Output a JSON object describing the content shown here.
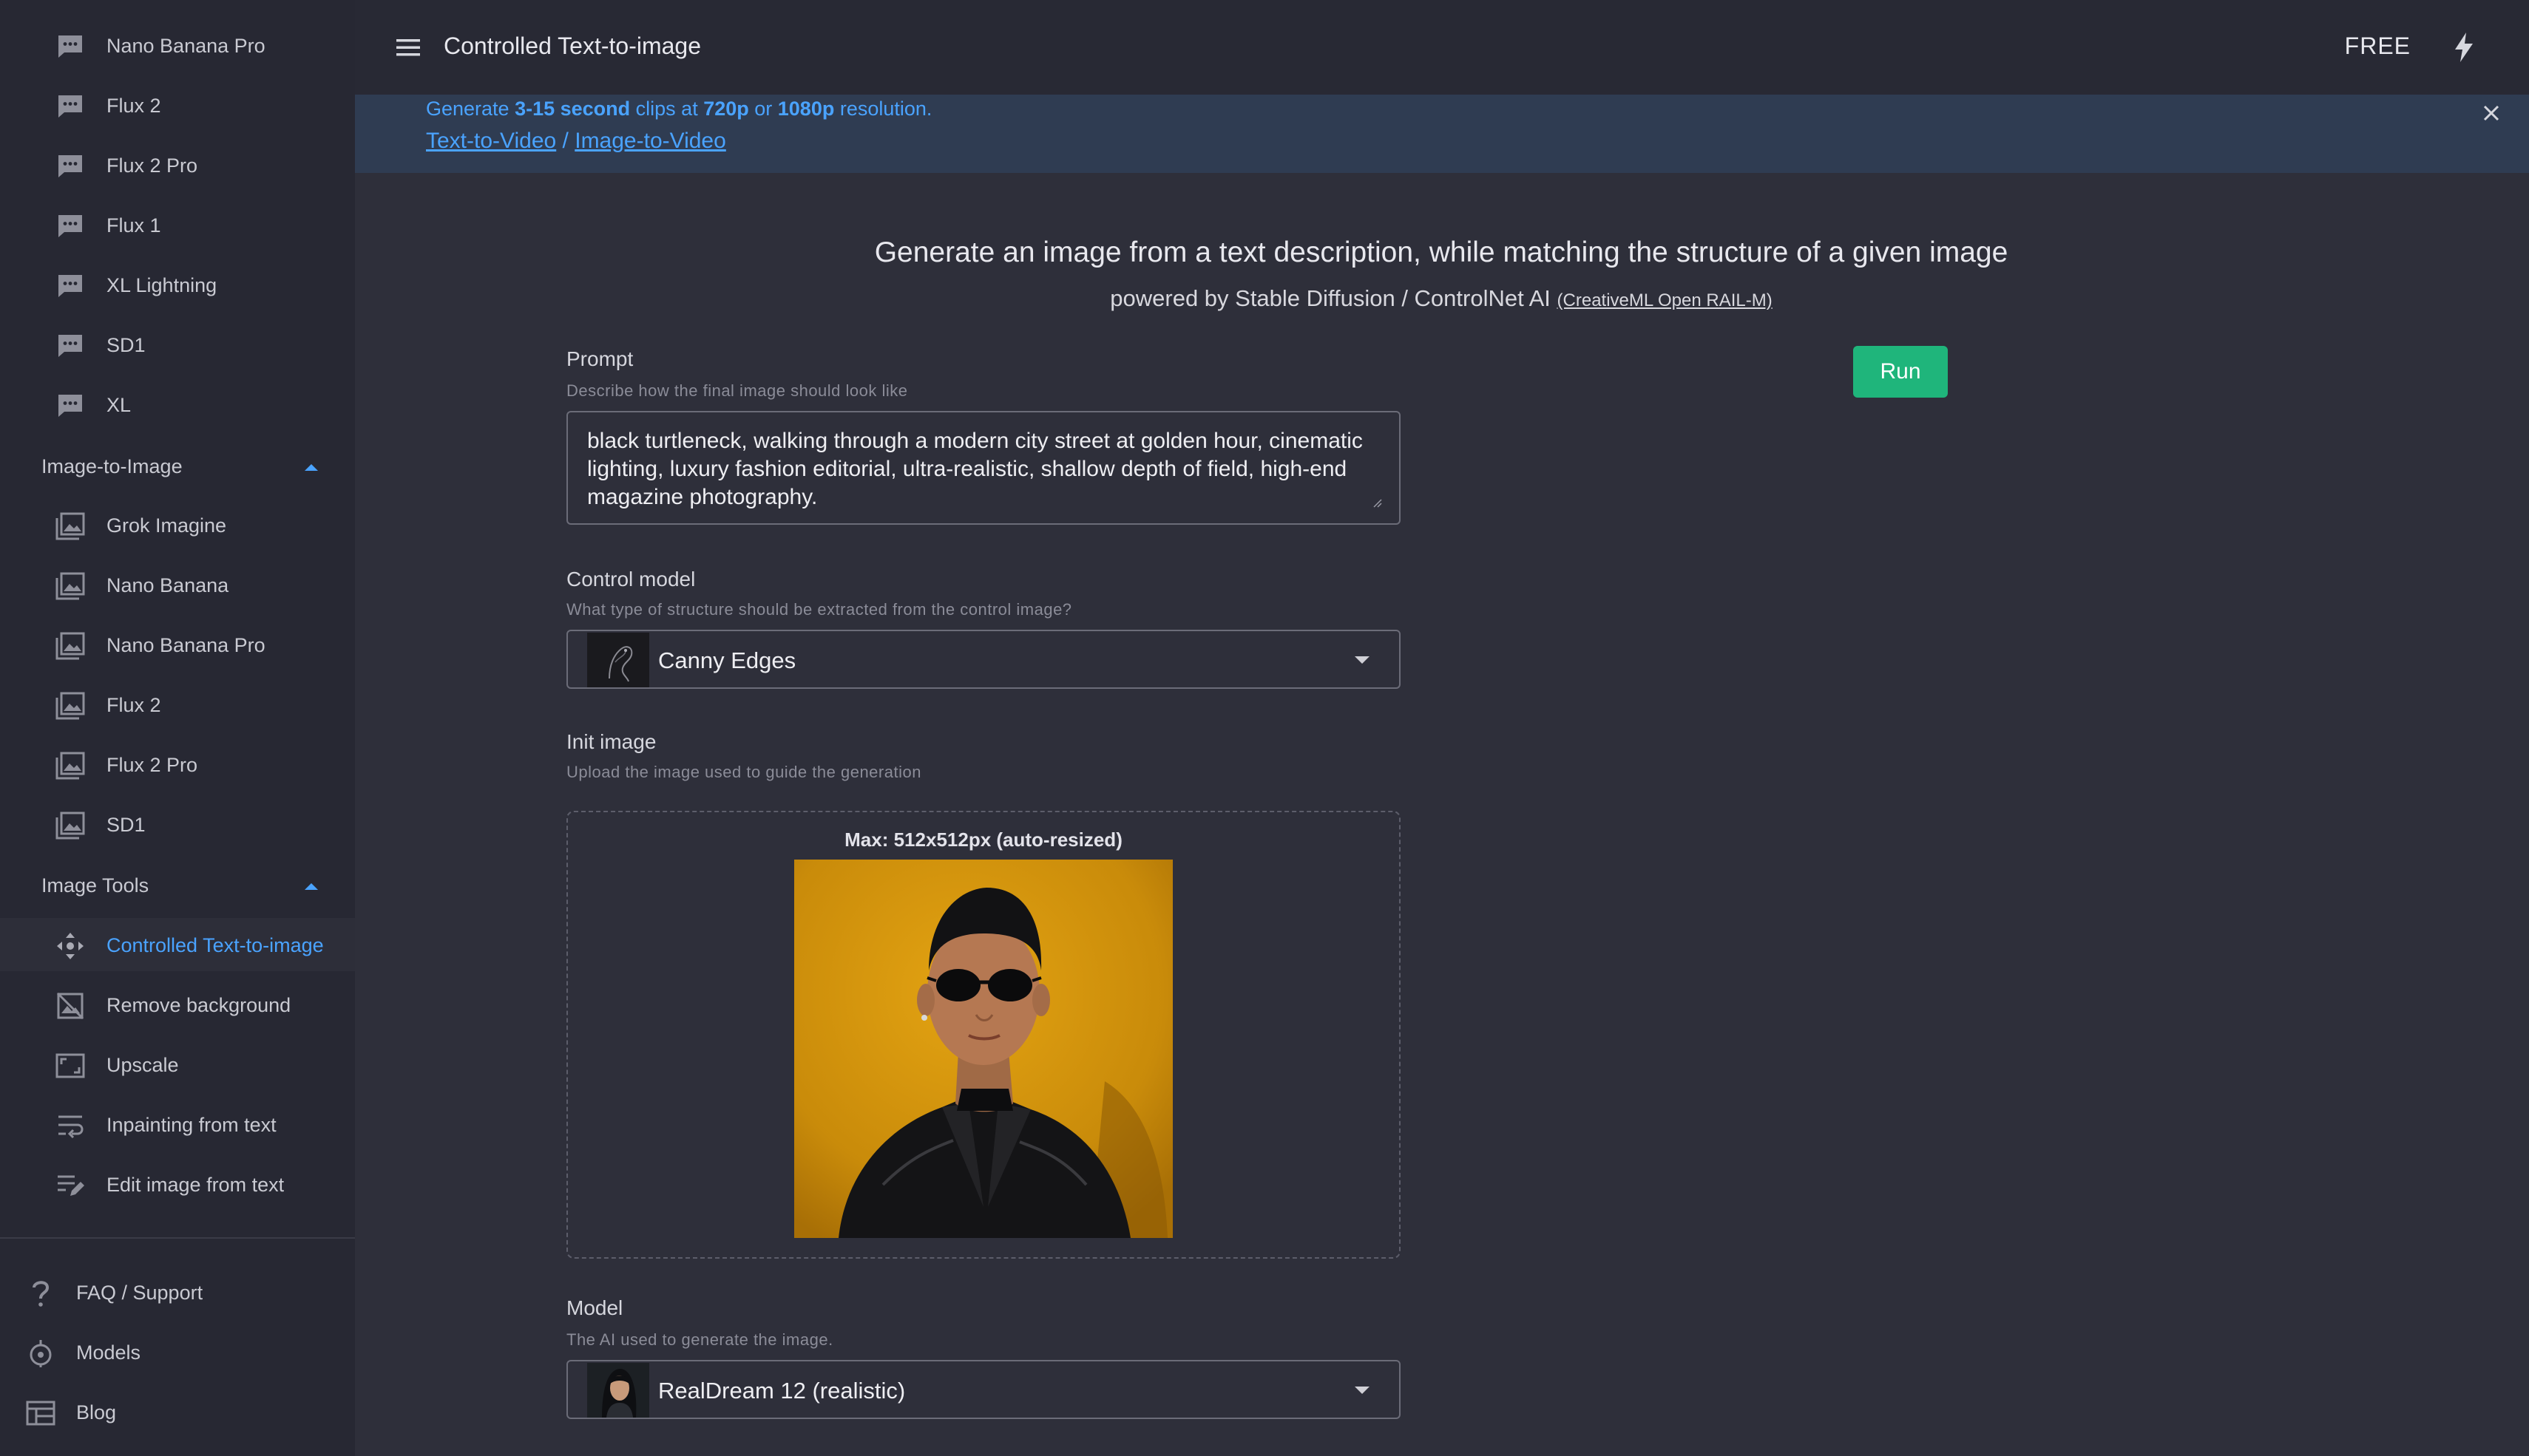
{
  "sidebar": {
    "text_to_image_items": [
      {
        "label": "Nano Banana Pro",
        "icon": "chat-bubble-icon"
      },
      {
        "label": "Flux 2",
        "icon": "chat-bubble-icon"
      },
      {
        "label": "Flux 2 Pro",
        "icon": "chat-bubble-icon"
      },
      {
        "label": "Flux 1",
        "icon": "chat-bubble-icon"
      },
      {
        "label": "XL Lightning",
        "icon": "chat-bubble-icon"
      },
      {
        "label": "SD1",
        "icon": "chat-bubble-icon"
      },
      {
        "label": "XL",
        "icon": "chat-bubble-icon"
      }
    ],
    "image_to_image": {
      "title": "Image-to-Image",
      "items": [
        {
          "label": "Grok Imagine",
          "icon": "image-icon"
        },
        {
          "label": "Nano Banana",
          "icon": "image-icon"
        },
        {
          "label": "Nano Banana Pro",
          "icon": "image-icon"
        },
        {
          "label": "Flux 2",
          "icon": "image-icon"
        },
        {
          "label": "Flux 2 Pro",
          "icon": "image-icon"
        },
        {
          "label": "SD1",
          "icon": "image-icon"
        }
      ]
    },
    "image_tools": {
      "title": "Image Tools",
      "items": [
        {
          "label": "Controlled Text-to-image",
          "icon": "move-arrows-icon",
          "active": true
        },
        {
          "label": "Remove background",
          "icon": "image-off-icon"
        },
        {
          "label": "Upscale",
          "icon": "aspect-ratio-icon"
        },
        {
          "label": "Inpainting from text",
          "icon": "wrap-text-icon"
        },
        {
          "label": "Edit image from text",
          "icon": "edit-note-icon"
        }
      ]
    },
    "footer": [
      {
        "label": "FAQ / Support",
        "icon": "question-icon"
      },
      {
        "label": "Models",
        "icon": "models-icon"
      },
      {
        "label": "Blog",
        "icon": "blog-icon"
      }
    ]
  },
  "topbar": {
    "title": "Controlled Text-to-image",
    "plan": "FREE"
  },
  "banner": {
    "text_parts": [
      "Generate ",
      "3-15 second",
      " clips at ",
      "720p",
      " or ",
      "1080p",
      " resolution."
    ],
    "link_text_to_video": "Text-to-Video",
    "separator": " / ",
    "link_image_to_video": "Image-to-Video"
  },
  "main": {
    "heading": "Generate an image from a text description, while matching the structure of a given image",
    "subheading": "powered by Stable Diffusion / ControlNet AI ",
    "license": "(CreativeML Open RAIL-M)",
    "run_label": "Run",
    "prompt": {
      "label": "Prompt",
      "hint": "Describe how the final image should look like",
      "value": "black turtleneck, walking through a modern city street at golden hour, cinematic lighting, luxury fashion editorial, ultra-realistic, shallow depth of field, high-end magazine photography."
    },
    "control_model": {
      "label": "Control model",
      "hint": "What type of structure should be extracted from the control image?",
      "value": "Canny Edges"
    },
    "init_image": {
      "label": "Init image",
      "hint": "Upload the image used to guide the generation",
      "max_note": "Max: 512x512px (auto-resized)"
    },
    "model": {
      "label": "Model",
      "hint": "The AI used to generate the image.",
      "value": "RealDream 12 (realistic)"
    }
  },
  "colors": {
    "accent": "#4aa3ff",
    "run_button": "#1fb57b",
    "background": "#2e2f3a",
    "sidebar": "#272833",
    "banner": "#2f3c52"
  }
}
